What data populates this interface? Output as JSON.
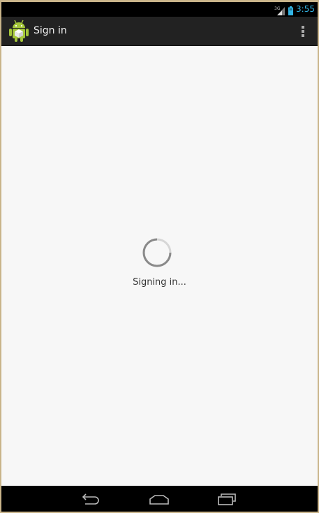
{
  "status_bar": {
    "network_label": "3G",
    "time": "3:55",
    "icons": [
      "signal-icon",
      "battery-icon"
    ],
    "accent_color": "#33b5e5"
  },
  "action_bar": {
    "icon": "android-icon",
    "title": "Sign in",
    "overflow_icon": "overflow-menu-icon"
  },
  "content": {
    "progress_indicator": "spinner",
    "progress_message": "Signing in..."
  },
  "nav_bar": {
    "buttons": [
      "back-icon",
      "home-icon",
      "recent-apps-icon"
    ]
  }
}
